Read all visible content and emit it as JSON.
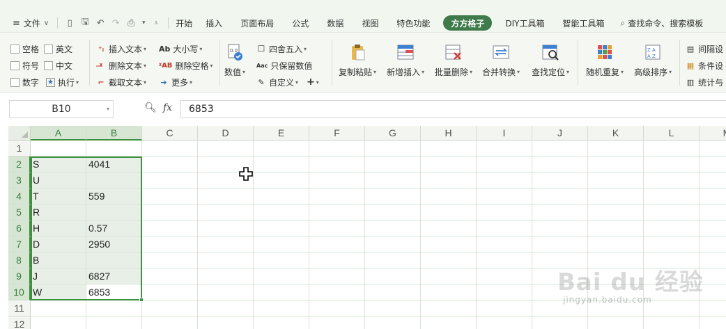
{
  "menubar": {
    "file_label": "文件",
    "tabs": [
      "开始",
      "插入",
      "页面布局",
      "公式",
      "数据",
      "视图",
      "特色功能",
      "方方格子",
      "DIY工具箱",
      "智能工具箱"
    ],
    "active_tab": "方方格子",
    "search_label": "查找命令、搜索模板"
  },
  "ribbon": {
    "checks": {
      "space": "空格",
      "english": "英文",
      "symbol": "符号",
      "chinese": "中文",
      "digit": "数字",
      "execute": "执行"
    },
    "text_ops": {
      "insert_text": "插入文本",
      "delete_text": "删除文本",
      "extract_text": "截取文本",
      "upper_lower": "大小写",
      "delete_space": "删除空格",
      "more": "更多"
    },
    "number_ops": {
      "numeric": "数值",
      "round": "四舍五入",
      "keep_number": "只保留数值",
      "custom": "自定义"
    },
    "big_buttons": {
      "copy_paste": "复制粘贴",
      "add_insert": "新增插入",
      "batch_delete": "批量删除",
      "merge_convert": "合并转换",
      "find_locate": "查找定位",
      "random_repeat": "随机重复",
      "advanced_sort": "高级排序"
    },
    "right_ops": {
      "interval_set": "间隔设",
      "condition_set": "条件设",
      "stats": "统计与"
    },
    "icon_labels": {
      "case_icon": "Ab",
      "delete_space_icon": "ᵡAB",
      "round_icon": "☐",
      "keep_icon": "Aac"
    }
  },
  "formula_bar": {
    "name_box": "B10",
    "fx_label": "fx",
    "value": "6853"
  },
  "grid": {
    "columns": [
      "A",
      "B",
      "C",
      "D",
      "E",
      "F",
      "G",
      "H",
      "I",
      "J",
      "K",
      "L",
      "M"
    ],
    "row_numbers": [
      "1",
      "2",
      "3",
      "4",
      "5",
      "6",
      "7",
      "8",
      "9",
      "10",
      "11",
      "12"
    ],
    "col_a": [
      "",
      "S",
      "U",
      "T",
      "R",
      "H",
      "D",
      "B",
      "J",
      "W",
      "",
      ""
    ],
    "col_b": [
      "",
      "4041",
      "",
      "559",
      "",
      "0.57",
      "2950",
      "",
      "6827",
      "6853",
      "",
      ""
    ],
    "selected_range": "A2:B10",
    "active_cell": "B10"
  },
  "watermark": {
    "brand": "Bai du 经验",
    "url": "jingyan.baidu.com"
  },
  "colors": {
    "accent": "#3f7a4a",
    "selection_border": "#3f9142",
    "selection_fill": "#e8efe6",
    "header_selected": "#d6e6d3"
  }
}
